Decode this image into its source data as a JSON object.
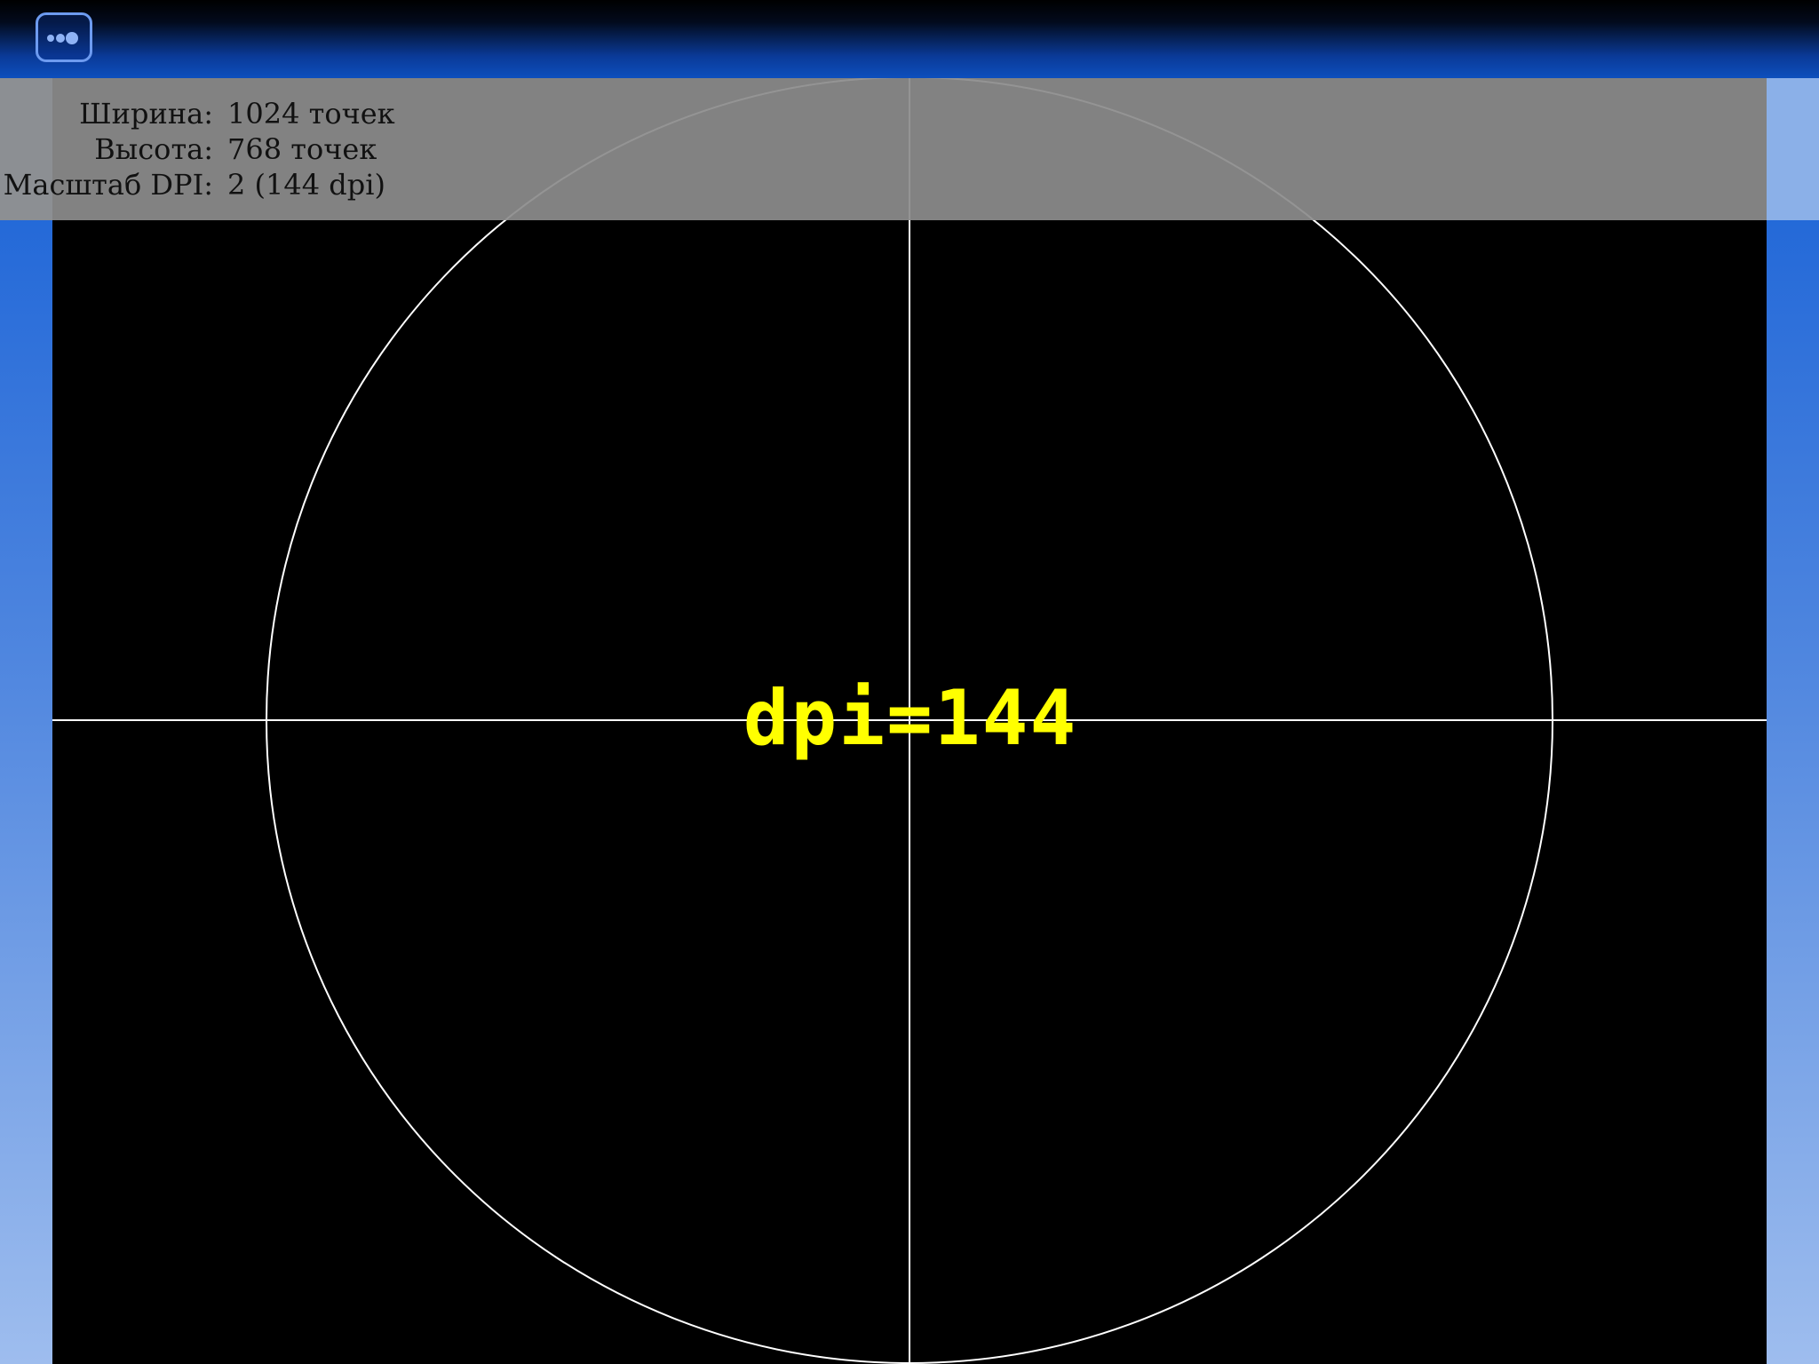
{
  "menu": {
    "icon": "ellipsis-icon"
  },
  "info": {
    "rows": [
      {
        "label": "Ширина:",
        "value": "1024 точек"
      },
      {
        "label": "Высота:",
        "value": "768 точек"
      },
      {
        "label": "Масштаб DPI:",
        "value": "2 (144 dpi)"
      }
    ]
  },
  "test_pattern": {
    "dpi_label": "dpi=144"
  },
  "colors": {
    "accent": "#0d4fbd",
    "label": "#ffff00",
    "lines": "#ffffff"
  }
}
